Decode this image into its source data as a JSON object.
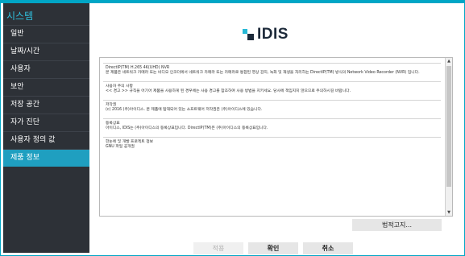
{
  "sidebar": {
    "title": "시스템",
    "items": [
      {
        "label": "일반"
      },
      {
        "label": "날짜/시간"
      },
      {
        "label": "사용자"
      },
      {
        "label": "보안"
      },
      {
        "label": "저장 공간"
      },
      {
        "label": "자가 진단"
      },
      {
        "label": "사용자 정의 값"
      },
      {
        "label": "제품 정보",
        "active": true
      }
    ]
  },
  "logo": {
    "text": "IDIS",
    "icon": "idis-logo"
  },
  "license": {
    "sections": [
      {
        "title": "DirectIP(TM) H.265 4K(UHD) NVR",
        "body": "본 제품은 네트워크 카메라 또는 비디오 인코더에서 네트워크 카메라 또는 카메라로 통합된 영상 감지, 녹화 및 재생을 처리하는 DirectIP(TM) 방식의 Network Video Recorder (NVR) 입니다."
      },
      {
        "title": "사용자 주의 사항",
        "body": "<< 경고 >> 규칙을 어기어 제품을 사용하게 된 경우에는 사용 경고를 참조하여 사용 방법을 지키세요. 당사에 책임지지 않으므로 주의하시길 바랍니다."
      },
      {
        "title": "저작권",
        "body": "(c) 2016 (주)아이디스. 본 제품에 탑재되어 있는 소프트웨어 저작권은 (주)아이디스에 있습니다."
      },
      {
        "title": "등록상표",
        "body": "아이디스, IDIS는 (주)아이디스의 등록상표입니다. DirectIP(TM)은 (주)아이디스의 등록상표입니다."
      },
      {
        "title": "한눈에 및 개발 프로젝트 정보",
        "body": "GNU 파일 공개권"
      }
    ]
  },
  "buttons": {
    "legal": "법적고지...",
    "apply": "적용",
    "ok": "확인",
    "cancel": "취소"
  },
  "colors": {
    "accent": "#00a6c6",
    "sidebar": "#2d3137",
    "active": "#1f9fc0"
  }
}
